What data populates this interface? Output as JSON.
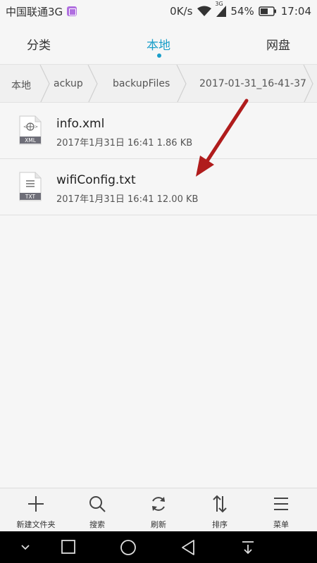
{
  "status_bar": {
    "carrier": "中国联通3G",
    "net_speed": "0K/s",
    "signal_tag": "3G",
    "battery": "54%",
    "time": "17:04"
  },
  "tabs": {
    "category": "分类",
    "local": "本地",
    "cloud": "网盘"
  },
  "breadcrumb": [
    "本地",
    "ackup",
    "backupFiles",
    "2017-01-31_16-41-37"
  ],
  "files": [
    {
      "name": "info.xml",
      "meta": "2017年1月31日 16:41 1.86 KB",
      "type": "XML"
    },
    {
      "name": "wifiConfig.txt",
      "meta": "2017年1月31日 16:41 12.00 KB",
      "type": "TXT"
    }
  ],
  "toolbar": {
    "new_folder": "新建文件夹",
    "search": "搜索",
    "refresh": "刷新",
    "sort": "排序",
    "menu": "菜单"
  },
  "icons": {
    "carrier_badge": "gallery-badge-icon",
    "wifi": "wifi-icon",
    "signal": "cellular-signal-icon",
    "battery": "battery-icon"
  },
  "colors": {
    "accent": "#1a9ec9",
    "arrow": "#b01c1c"
  }
}
